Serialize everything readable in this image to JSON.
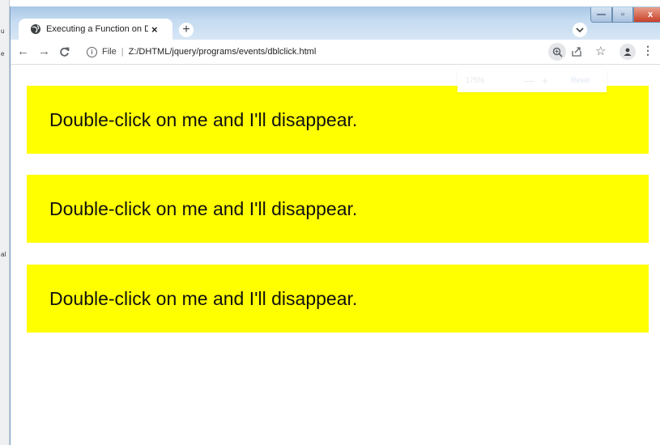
{
  "desktop": {
    "fragments": [
      "u",
      "e",
      "al"
    ]
  },
  "browser": {
    "tab": {
      "title": "Executing a Function on Double-"
    },
    "new_tab_label": "+",
    "tab_close_label": "×",
    "window_buttons": {
      "minimize": "—",
      "maximize": "▫",
      "close": "x"
    },
    "address": {
      "scheme_label": "File",
      "separator": "|",
      "url": "Z:/DHTML/jquery/programs/events/dblclick.html"
    },
    "zoom_popup": {
      "level": "175%",
      "minus": "—",
      "plus": "+",
      "reset": "Reset"
    }
  },
  "page": {
    "boxes": [
      {
        "text": "Double-click on me and I'll disappear."
      },
      {
        "text": "Double-click on me and I'll disappear."
      },
      {
        "text": "Double-click on me and I'll disappear."
      }
    ]
  },
  "colors": {
    "box_background": "#ffff00",
    "window_frame": "#a9c7e6",
    "close_button": "#c8412a"
  }
}
